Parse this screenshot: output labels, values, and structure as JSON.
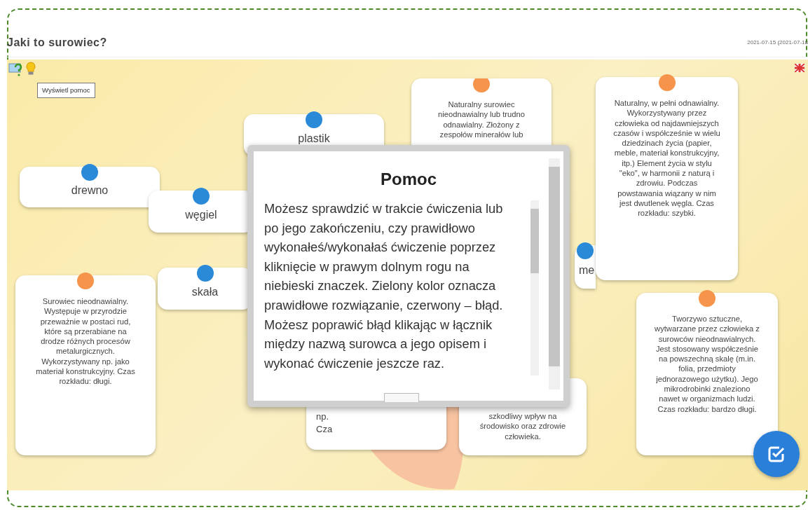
{
  "header": {
    "title": "Jaki to surowiec?",
    "date": "2021-07-15 (2021-07-18"
  },
  "help": {
    "tooltip": "Wyświetl pomoc"
  },
  "cards": [
    {
      "kind": "word",
      "color": "#2a8ad8",
      "text": "drewno"
    },
    {
      "kind": "word",
      "color": "#2a8ad8",
      "text": "węgiel"
    },
    {
      "kind": "word",
      "color": "#2a8ad8",
      "text": "plastik"
    },
    {
      "kind": "word",
      "color": "#2a8ad8",
      "text": "skała"
    },
    {
      "kind": "word",
      "color": "#2a8ad8",
      "text": "me"
    },
    {
      "kind": "description",
      "color": "#f5944a",
      "text": "Surowiec nieodnawialny. Występuje w przyrodzie przeważnie w postaci rud, które są przerabiane na drodze różnych procesów metalurgicznych. Wykorzystywany np. jako materiał konstrukcyjny. Czas rozkładu: długi."
    },
    {
      "kind": "description",
      "color": "#f5944a",
      "text": "Naturalny surowiec nieodnawialny lub trudno odnawialny. Złożony z zespołów minerałów lub"
    },
    {
      "kind": "description",
      "color": "#f5944a",
      "text": "Naturalny, w pełni odnawialny. Wykorzystywany przez człowieka od najdawniejszych czasów i współcześnie w wielu dziedzinach życia (papier, meble, materiał konstrukcyjny, itp.) Element życia w stylu \"eko\", w harmonii z naturą i zdrowiu. Podczas powstawania wiązany w nim jest dwutlenek węgla. Czas rozkładu: szybki."
    },
    {
      "kind": "description",
      "color": "#f5944a",
      "text": "Tworzywo sztuczne, wytwarzane przez człowieka z surowców nieodnawialnych. Jest stosowany współcześnie na powszechną skalę (m.in. folia, przedmioty jednorazowego użytku). Jego mikrodrobinki znaleziono nawet w organizmach ludzi. Czas rozkładu: bardzo długi."
    },
    {
      "kind": "fragment",
      "text": "np."
    },
    {
      "kind": "fragment",
      "text": "Cza"
    },
    {
      "kind": "description",
      "text": "szkodliwy wpływ na środowisko oraz zdrowie człowieka."
    }
  ],
  "modal": {
    "title": "Pomoc",
    "text": "Możesz sprawdzić w trakcie ćwiczenia lub po jego zakończeniu, czy prawidłowo wykonałeś/wykonałaś ćwiczenie poprzez kliknięcie w prawym dolnym rogu na niebieski znaczek. Zielony kolor oznacza prawidłowe rozwiązanie, czerwony – błąd. Możesz poprawić błąd klikając w łącznik między nazwą surowca a jego opisem i wykonać ćwiczenie jeszcze raz."
  }
}
